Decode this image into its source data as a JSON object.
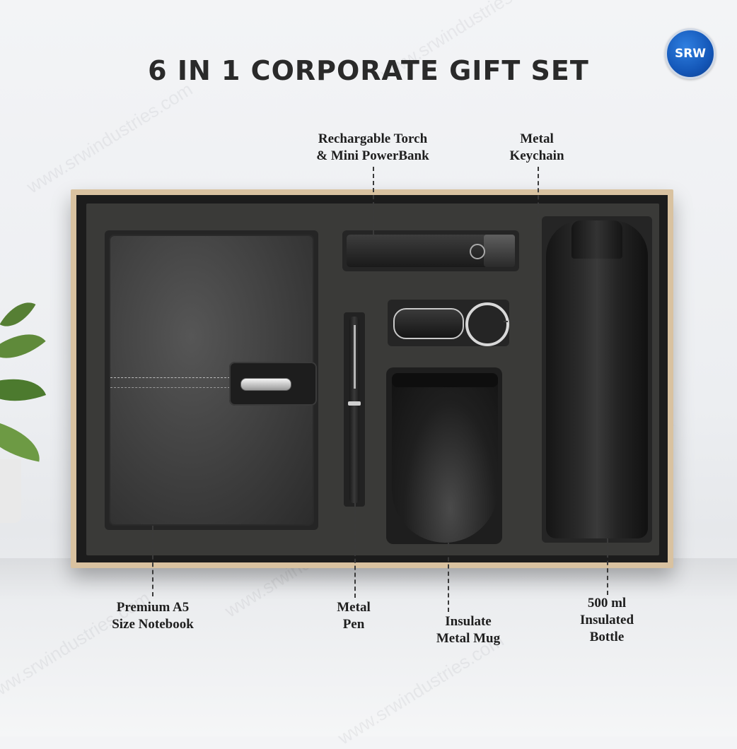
{
  "title": "6 IN 1 CORPORATE GIFT SET",
  "logo": {
    "text": "SRW",
    "color": "#1457b8"
  },
  "watermark": "www.srwindustries.com",
  "labels": {
    "torch": {
      "line1": "Rechargable Torch",
      "line2": "& Mini PowerBank"
    },
    "keychain": {
      "line1": "Metal",
      "line2": "Keychain"
    },
    "notebook": {
      "line1": "Premium A5",
      "line2": "Size Notebook"
    },
    "pen": {
      "line1": "Metal",
      "line2": "Pen"
    },
    "mug": {
      "line1": "Insulate",
      "line2": "Metal Mug"
    },
    "bottle": {
      "line1": "500 ml",
      "line2": "Insulated",
      "line3": "Bottle"
    }
  }
}
